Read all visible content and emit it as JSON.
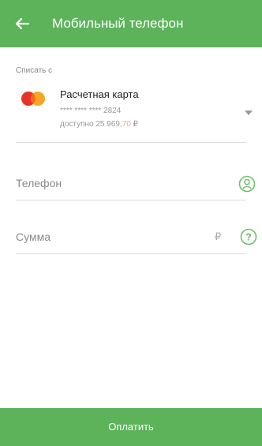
{
  "appbar": {
    "title": "Мобильный телефон",
    "back_icon": "arrow-back-icon",
    "color": "#5cb35a"
  },
  "payment_source": {
    "label": "Списать с",
    "card_name": "Расчетная карта",
    "card_number": "**** **** **** 2824",
    "balance_prefix": "доступно 25 969,",
    "balance_cents": "70",
    "balance_currency": " ₽",
    "card_icon": "mastercard-icon",
    "dropdown_icon": "chevron-down-icon"
  },
  "phone_field": {
    "placeholder": "Телефон",
    "contact_icon": "contact-icon"
  },
  "amount_field": {
    "placeholder": "Сумма",
    "currency": "₽",
    "help_icon": "help-icon"
  },
  "pay_button": {
    "label": "Оплатить"
  }
}
